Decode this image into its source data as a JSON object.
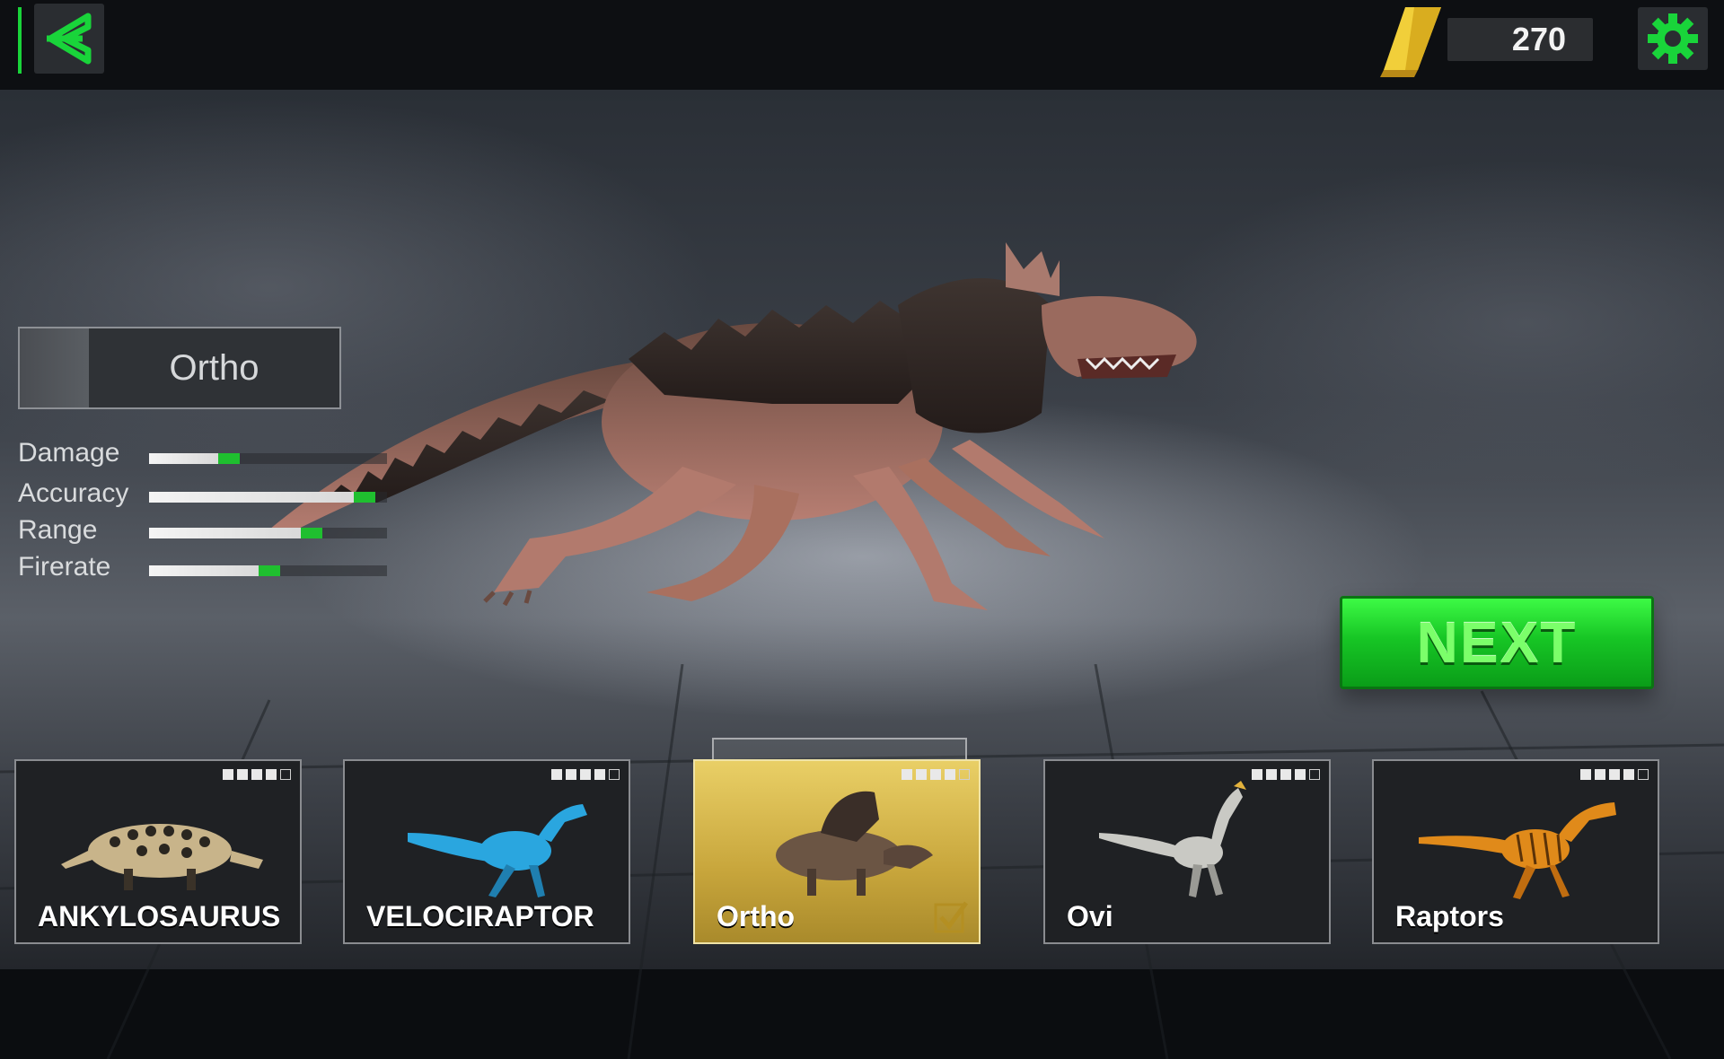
{
  "header": {
    "back_icon": "back-arrow-icon",
    "currency_icon": "gold-bar-icon",
    "gold_amount": "270",
    "settings_icon": "gear-icon"
  },
  "selected_dino": {
    "name": "Ortho"
  },
  "stats": [
    {
      "label": "Damage",
      "level": 0.38
    },
    {
      "label": "Accuracy",
      "level": 0.95
    },
    {
      "label": "Range",
      "level": 0.73
    },
    {
      "label": "Firerate",
      "level": 0.55
    }
  ],
  "next_button": {
    "label": "NEXT"
  },
  "cards": [
    {
      "label": "ANKYLOSAURUS",
      "rating_filled": 4,
      "rating_total": 5,
      "selected": false,
      "color": "#c8b48a"
    },
    {
      "label": "VELOCIRAPTOR",
      "rating_filled": 4,
      "rating_total": 5,
      "selected": false,
      "color": "#2aa6df"
    },
    {
      "label": "Ortho",
      "rating_filled": 4,
      "rating_total": 5,
      "selected": true,
      "color": "#6b5544"
    },
    {
      "label": "Ovi",
      "rating_filled": 4,
      "rating_total": 5,
      "selected": false,
      "color": "#c9c9c4"
    },
    {
      "label": "Raptors",
      "rating_filled": 4,
      "rating_total": 5,
      "selected": false,
      "color": "#e08a1a"
    }
  ],
  "colors": {
    "accent_green": "#19d43a",
    "gold": "#e9c233"
  }
}
